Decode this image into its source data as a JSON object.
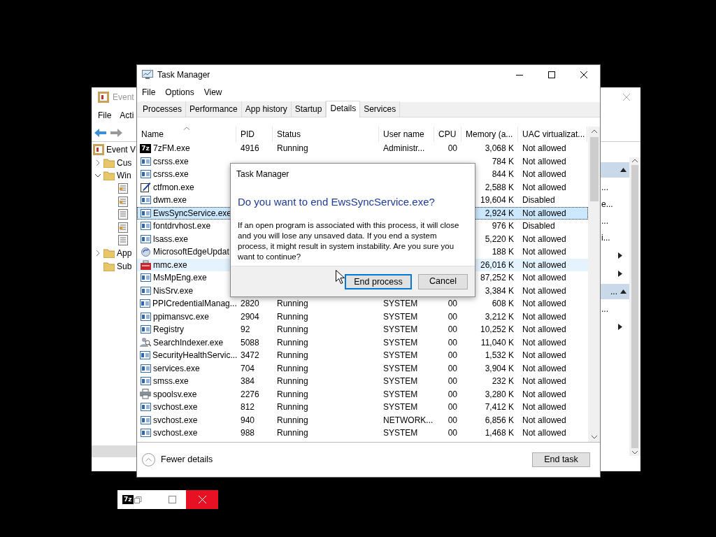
{
  "event_viewer": {
    "title": "Event",
    "menu": [
      "File",
      "Acti"
    ],
    "tree": [
      {
        "label": "Event V",
        "children": [
          {
            "label": "Cus",
            "expanded": false
          },
          {
            "label": "Win",
            "expanded": true,
            "children": [
              {
                "kind": "log-colored"
              },
              {
                "kind": "log-colored"
              },
              {
                "kind": "log-plain"
              },
              {
                "kind": "log-colored"
              },
              {
                "kind": "log-plain"
              }
            ]
          },
          {
            "label": "App",
            "expanded": false
          },
          {
            "label": "Sub"
          }
        ]
      }
    ],
    "actions": [
      {
        "kind": "header",
        "expanded": true
      },
      {
        "kind": "item",
        "text": "..."
      },
      {
        "kind": "item",
        "text": "e..."
      },
      {
        "kind": "item",
        "text": "..."
      },
      {
        "kind": "item",
        "text": "i..."
      },
      {
        "kind": "submenu"
      },
      {
        "kind": "submenu"
      },
      {
        "kind": "header",
        "text": "...",
        "expanded": true
      },
      {
        "kind": "item",
        "text": "..."
      },
      {
        "kind": "submenu"
      }
    ]
  },
  "task_manager": {
    "title": "Task Manager",
    "menu": [
      "File",
      "Options",
      "View"
    ],
    "tabs": [
      {
        "label": "Processes",
        "selected": false
      },
      {
        "label": "Performance",
        "selected": false
      },
      {
        "label": "App history",
        "selected": false
      },
      {
        "label": "Startup",
        "selected": false
      },
      {
        "label": "Details",
        "selected": true
      },
      {
        "label": "Services",
        "selected": false
      }
    ],
    "columns": [
      {
        "label": "Name",
        "sorted": true
      },
      {
        "label": "PID",
        "sorted": false
      },
      {
        "label": "Status",
        "sorted": false
      },
      {
        "label": "User name",
        "sorted": false
      },
      {
        "label": "CPU",
        "sorted": false
      },
      {
        "label": "Memory (a...",
        "sorted": false
      },
      {
        "label": "UAC virtualizat...",
        "sorted": false
      }
    ],
    "rows": [
      {
        "kind": "archive",
        "logo": "7z",
        "name": "7zFM.exe",
        "pid": "4916",
        "status": "Running",
        "user": "Administr...",
        "cpu": "00",
        "memory": "3,068 K",
        "uac": "Not allowed",
        "selected": false,
        "hovered": false
      },
      {
        "kind": "exe",
        "name": "csrss.exe",
        "memory": "784 K",
        "uac": "Not allowed",
        "selected": false,
        "hovered": false
      },
      {
        "kind": "exe",
        "name": "csrss.exe",
        "memory": "844 K",
        "uac": "Not allowed",
        "selected": false,
        "hovered": false
      },
      {
        "kind": "pen",
        "name": "ctfmon.exe",
        "memory": "2,588 K",
        "uac": "Not allowed",
        "selected": false,
        "hovered": false
      },
      {
        "kind": "exe",
        "name": "dwm.exe",
        "memory": "19,604 K",
        "uac": "Disabled",
        "selected": false,
        "hovered": false
      },
      {
        "kind": "exe",
        "name": "EwsSyncService.exe",
        "memory": "2,924 K",
        "uac": "Not allowed",
        "selected": true,
        "hovered": false
      },
      {
        "kind": "exe",
        "name": "fontdrvhost.exe",
        "memory": "976 K",
        "uac": "Disabled",
        "selected": false,
        "hovered": false
      },
      {
        "kind": "exe",
        "name": "lsass.exe",
        "memory": "5,220 K",
        "uac": "Not allowed",
        "selected": false,
        "hovered": false
      },
      {
        "kind": "update",
        "name": "MicrosoftEdgeUpdat",
        "memory": "188 K",
        "uac": "Not allowed",
        "selected": false,
        "hovered": false
      },
      {
        "kind": "toolbox",
        "name": "mmc.exe",
        "memory": "26,016 K",
        "uac": "Not allowed",
        "selected": false,
        "hovered": true
      },
      {
        "kind": "exe",
        "name": "MsMpEng.exe",
        "memory": "87,252 K",
        "uac": "Not allowed",
        "selected": false,
        "hovered": false
      },
      {
        "kind": "exe",
        "name": "NisSrv.exe",
        "memory": "3,384 K",
        "uac": "Not allowed",
        "selected": false,
        "hovered": false
      },
      {
        "kind": "exe",
        "name": "PPICredentialManag...",
        "pid": "2820",
        "status": "Running",
        "user": "SYSTEM",
        "cpu": "00",
        "memory": "608 K",
        "uac": "Not allowed",
        "selected": false,
        "hovered": false
      },
      {
        "kind": "exe",
        "name": "ppimansvc.exe",
        "pid": "2904",
        "status": "Running",
        "user": "SYSTEM",
        "cpu": "00",
        "memory": "3,212 K",
        "uac": "Not allowed",
        "selected": false,
        "hovered": false
      },
      {
        "kind": "exe",
        "name": "Registry",
        "pid": "92",
        "status": "Running",
        "user": "SYSTEM",
        "cpu": "00",
        "memory": "10,252 K",
        "uac": "Not allowed",
        "selected": false,
        "hovered": false
      },
      {
        "kind": "search",
        "name": "SearchIndexer.exe",
        "pid": "5088",
        "status": "Running",
        "user": "SYSTEM",
        "cpu": "00",
        "memory": "11,040 K",
        "uac": "Not allowed",
        "selected": false,
        "hovered": false
      },
      {
        "kind": "exe",
        "name": "SecurityHealthServic...",
        "pid": "3472",
        "status": "Running",
        "user": "SYSTEM",
        "cpu": "00",
        "memory": "1,532 K",
        "uac": "Not allowed",
        "selected": false,
        "hovered": false
      },
      {
        "kind": "exe",
        "name": "services.exe",
        "pid": "704",
        "status": "Running",
        "user": "SYSTEM",
        "cpu": "00",
        "memory": "3,904 K",
        "uac": "Not allowed",
        "selected": false,
        "hovered": false
      },
      {
        "kind": "exe",
        "name": "smss.exe",
        "pid": "384",
        "status": "Running",
        "user": "SYSTEM",
        "cpu": "00",
        "memory": "232 K",
        "uac": "Not allowed",
        "selected": false,
        "hovered": false
      },
      {
        "kind": "printer",
        "name": "spoolsv.exe",
        "pid": "2276",
        "status": "Running",
        "user": "SYSTEM",
        "cpu": "00",
        "memory": "3,280 K",
        "uac": "Not allowed",
        "selected": false,
        "hovered": false
      },
      {
        "kind": "exe",
        "name": "svchost.exe",
        "pid": "812",
        "status": "Running",
        "user": "SYSTEM",
        "cpu": "00",
        "memory": "7,412 K",
        "uac": "Not allowed",
        "selected": false,
        "hovered": false
      },
      {
        "kind": "exe",
        "name": "svchost.exe",
        "pid": "940",
        "status": "Running",
        "user": "NETWORK...",
        "cpu": "00",
        "memory": "6,856 K",
        "uac": "Not allowed",
        "selected": false,
        "hovered": false
      },
      {
        "kind": "exe",
        "name": "svchost.exe",
        "pid": "988",
        "status": "Running",
        "user": "SYSTEM",
        "cpu": "00",
        "memory": "1,468 K",
        "uac": "Not allowed",
        "selected": false,
        "hovered": false
      }
    ],
    "fewer_details": "Fewer details",
    "end_task": "End task"
  },
  "dialog": {
    "title": "Task Manager",
    "heading": "Do you want to end EwsSyncService.exe?",
    "body": "If an open program is associated with this process, it will close and you will lose any unsaved data. If you end a system process, it might result in system instability. Are you sure you want to continue?",
    "buttons": [
      {
        "label": "End process",
        "default": true
      },
      {
        "label": "Cancel",
        "default": false
      }
    ]
  },
  "mini_window": {
    "logo": "7z"
  }
}
